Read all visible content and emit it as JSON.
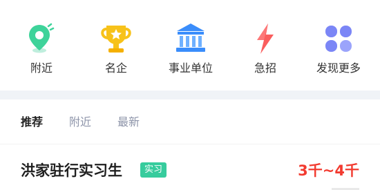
{
  "categories": [
    {
      "label": "附近",
      "icon": "location-pin-icon",
      "color": "#3ed39a"
    },
    {
      "label": "名企",
      "icon": "trophy-star-icon",
      "color": "#f7c21a"
    },
    {
      "label": "事业单位",
      "icon": "government-building-icon",
      "color": "#3a8dfb"
    },
    {
      "label": "急招",
      "icon": "lightning-bolt-icon",
      "color": "#fa5d5d"
    },
    {
      "label": "发现更多",
      "icon": "four-petal-grid-icon",
      "color": "#7b86f6"
    }
  ],
  "tabs": [
    {
      "label": "推荐",
      "active": true
    },
    {
      "label": "附近",
      "active": false
    },
    {
      "label": "最新",
      "active": false
    }
  ],
  "job": {
    "title": "洪家驻行实习生",
    "tag": "实习",
    "salary": "3千~4千",
    "tag_color": "#37cc9d",
    "salary_color": "#f23b30"
  }
}
